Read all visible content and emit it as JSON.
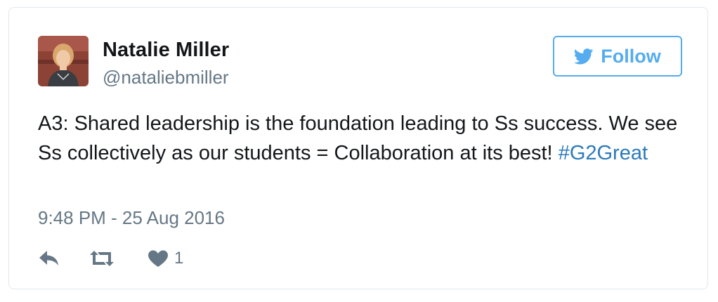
{
  "tweet": {
    "author": {
      "name": "Natalie Miller",
      "handle": "@nataliebmiller",
      "avatar": "profile-photo"
    },
    "follow_button": {
      "label": "Follow",
      "icon": "twitter-bird-icon"
    },
    "text": {
      "body": "A3: Shared leadership is the foundation leading to Ss success. We see Ss collectively as our students = Collaboration at its best!",
      "hashtag": "#G2Great"
    },
    "timestamp": "9:48 PM - 25 Aug 2016",
    "actions": {
      "reply_icon": "reply-icon",
      "retweet_icon": "retweet-icon",
      "like_icon": "heart-icon",
      "like_count": "1"
    }
  },
  "colors": {
    "text": "#14171a",
    "secondary": "#657786",
    "accent": "#55acee",
    "link": "#2b7bb9",
    "border": "#e1e8ed"
  }
}
